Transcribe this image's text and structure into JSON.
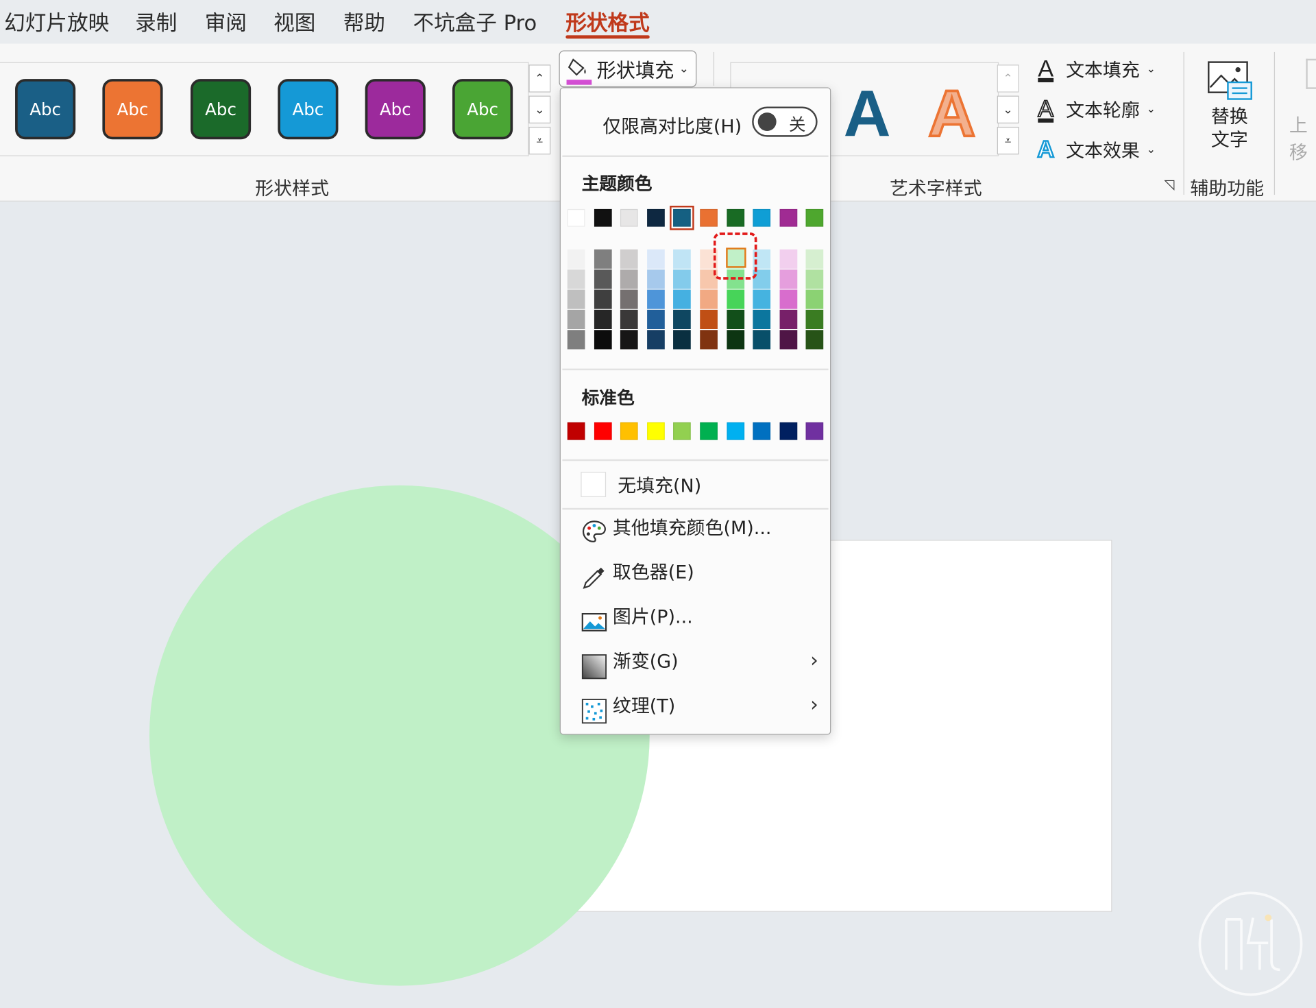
{
  "menubar": {
    "items": [
      "幻灯片放映",
      "录制",
      "审阅",
      "视图",
      "帮助",
      "不坑盒子 Pro",
      "形状格式"
    ],
    "active_index": 6,
    "active_color": "#c0391b"
  },
  "ribbon": {
    "shape_styles": {
      "buttons": [
        {
          "label": "Abc",
          "color": "#1a5f86"
        },
        {
          "label": "Abc",
          "color": "#ec7433"
        },
        {
          "label": "Abc",
          "color": "#1b6a2a"
        },
        {
          "label": "Abc",
          "color": "#1599d6"
        },
        {
          "label": "Abc",
          "color": "#9c2a9c"
        },
        {
          "label": "Abc",
          "color": "#4aa534"
        }
      ],
      "group_label": "形状样式"
    },
    "shape_fill": {
      "label": "形状填充",
      "bar_color": "#d64fd6"
    },
    "wordart": {
      "group_label": "艺术字样式",
      "preview_letter": "A",
      "text_fill": "文本填充",
      "text_outline": "文本轮廓",
      "text_effects": "文本效果"
    },
    "accessibility": {
      "button_line1": "替换",
      "button_line2": "文字",
      "group_label": "辅助功能"
    },
    "partial_label": "上移"
  },
  "dropdown": {
    "high_contrast_label": "仅限高对比度(H)",
    "high_contrast_key": "H",
    "toggle_state": "关",
    "theme_colors_title": "主题颜色",
    "theme_colors": [
      "#ffffff",
      "#111111",
      "#e7e6e6",
      "#0e2841",
      "#156082",
      "#e97132",
      "#196b24",
      "#0f9ed5",
      "#a02b93",
      "#4ea72e"
    ],
    "selected_theme_index": 4,
    "tints": [
      [
        "#f2f2f2",
        "#d8d8d8",
        "#bfbfbf",
        "#a5a5a5",
        "#7f7f7f"
      ],
      [
        "#7f7f7f",
        "#595959",
        "#3f3f3f",
        "#262626",
        "#0c0c0c"
      ],
      [
        "#d0cece",
        "#aeabab",
        "#757070",
        "#3a3838",
        "#171616"
      ],
      [
        "#dbe8f9",
        "#a6c9ec",
        "#4e95d9",
        "#215f9a",
        "#163e64"
      ],
      [
        "#c0e4f5",
        "#83cbeb",
        "#45b0e1",
        "#0f4761",
        "#0a2f40"
      ],
      [
        "#fbe2d5",
        "#f7c7ac",
        "#f1a983",
        "#c04f15",
        "#803310"
      ],
      [
        "#c1f0c8",
        "#83e28e",
        "#47d459",
        "#124f1a",
        "#0d3512"
      ],
      [
        "#c0e6f5",
        "#82cdeb",
        "#45b3e0",
        "#0c769e",
        "#084f69"
      ],
      [
        "#f2cfee",
        "#e59edd",
        "#d86dcd",
        "#772069",
        "#4f1546"
      ],
      [
        "#d6efd0",
        "#b0e1a1",
        "#8bd273",
        "#3a7c22",
        "#275317"
      ]
    ],
    "hover_tint": {
      "column": 6,
      "row": 0
    },
    "standard_colors_title": "标准色",
    "standard_colors": [
      "#c00000",
      "#ff0000",
      "#ffc000",
      "#ffff00",
      "#92d050",
      "#00b050",
      "#00b0f0",
      "#0070c0",
      "#002060",
      "#7030a0"
    ],
    "no_fill": {
      "label": "无填充(N)",
      "key": "N"
    },
    "more_colors": {
      "label": "其他填充颜色(M)...",
      "key": "M"
    },
    "eyedropper": {
      "label": "取色器(E)",
      "key": "E"
    },
    "picture": {
      "label": "图片(P)...",
      "key": "P"
    },
    "gradient": {
      "label": "渐变(G)",
      "key": "G"
    },
    "texture": {
      "label": "纹理(T)",
      "key": "T"
    }
  },
  "canvas": {
    "circle_color": "#c0f0c7",
    "rect_color": "#ffffff"
  }
}
